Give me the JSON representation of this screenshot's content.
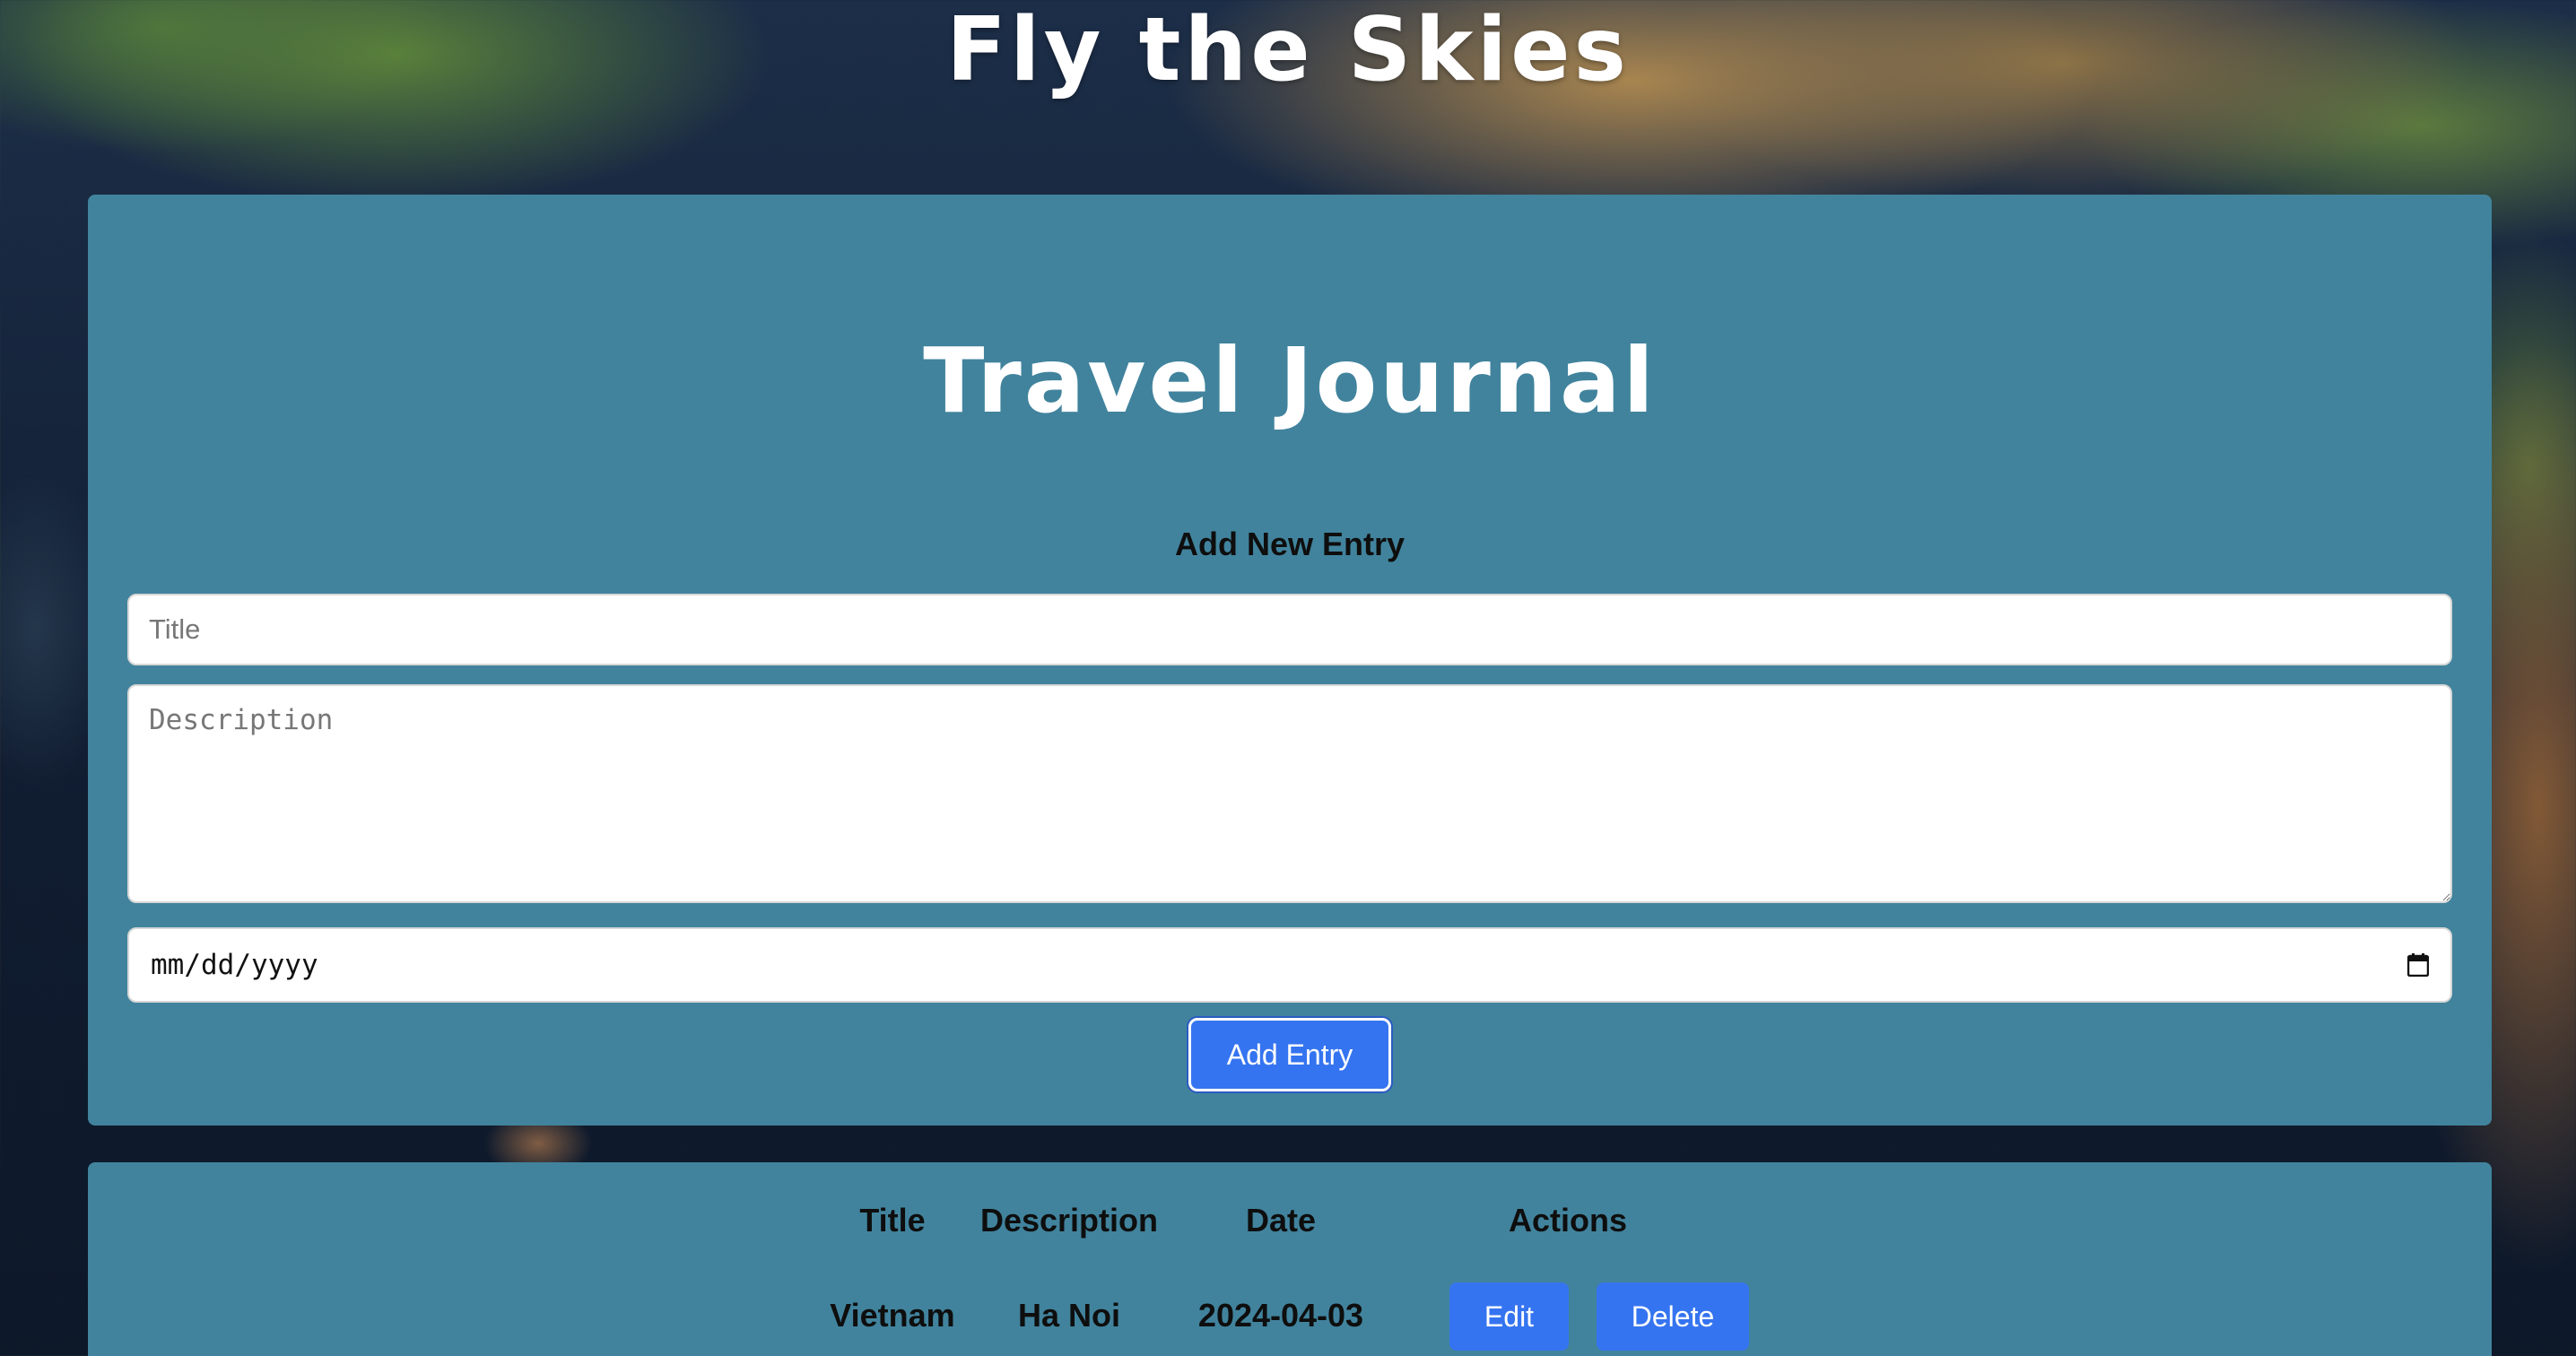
{
  "site": {
    "title": "Fly the Skies"
  },
  "journal": {
    "title": "Travel Journal"
  },
  "form": {
    "heading": "Add New Entry",
    "title_placeholder": "Title",
    "description_placeholder": "Description",
    "date_placeholder": "mm/dd/yyyy",
    "submit_label": "Add Entry"
  },
  "table": {
    "headers": {
      "title": "Title",
      "description": "Description",
      "date": "Date",
      "actions": "Actions"
    },
    "rows": [
      {
        "title": "Vietnam",
        "description": "Ha Noi",
        "date": "2024-04-03",
        "edit_label": "Edit",
        "delete_label": "Delete"
      }
    ]
  },
  "colors": {
    "panel": "#41839d",
    "button": "#3574f0",
    "text_dark": "#0e0e0e"
  },
  "icons": {
    "date_picker": "calendar-icon"
  }
}
